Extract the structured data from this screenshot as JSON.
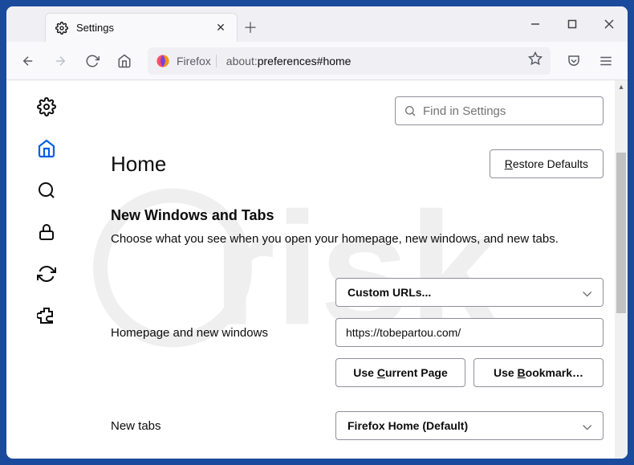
{
  "tab": {
    "title": "Settings"
  },
  "urlbar": {
    "label": "Firefox",
    "url_prefix": "about:",
    "url_rest": "preferences#home"
  },
  "search": {
    "placeholder": "Find in Settings"
  },
  "page": {
    "title": "Home",
    "restore": "Restore Defaults",
    "restore_u": "R",
    "restore_rest": "estore Defaults"
  },
  "section": {
    "title": "New Windows and Tabs",
    "desc": "Choose what you see when you open your homepage, new windows, and new tabs."
  },
  "rows": {
    "homepage_label": "Homepage and new windows",
    "homepage_select": "Custom URLs...",
    "homepage_url": "https://tobepartou.com/",
    "use_current_pre": "Use ",
    "use_current_u": "C",
    "use_current_post": "urrent Page",
    "use_bookmark_pre": "Use ",
    "use_bookmark_u": "B",
    "use_bookmark_post": "ookmark…",
    "newtabs_label": "New tabs",
    "newtabs_select": "Firefox Home (Default)"
  }
}
